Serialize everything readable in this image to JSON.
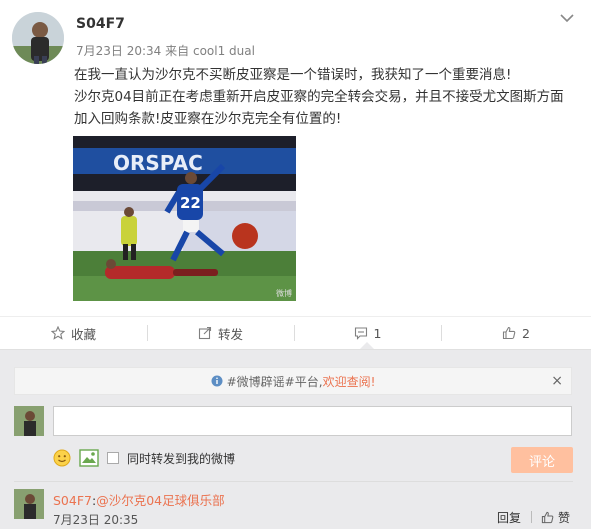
{
  "post": {
    "username": "S04F7",
    "date": "7月23日 20:34",
    "source_prefix": "来自",
    "source": "cool1 dual",
    "text_line1": "在我一直认为沙尔克不买断皮亚察是一个错误时，我获知了一个重要消息!",
    "text_line2": "沙尔克04目前正在考虑重新开启皮亚察的完全转会交易，并且不接受尤文图斯方面加入回购条款!皮亚察在沙尔克完全有位置的!",
    "image_watermark": "微博"
  },
  "actions": {
    "favorite": "收藏",
    "repost": "转发",
    "comment_count": "1",
    "like_count": "2"
  },
  "comments_section": {
    "notice_prefix": "#微博辟谣#平台,",
    "notice_link": "欢迎查阅!",
    "close_label": "×",
    "checkbox_label": "同时转发到我的微博",
    "submit_label": "评论",
    "comment": {
      "user": "S04F7",
      "colon": ":",
      "mention": "@沙尔克04足球俱乐部",
      "time": "7月23日 20:35",
      "reply": "回复",
      "like": "赞"
    }
  },
  "colors": {
    "accent": "#eb7350",
    "submit_bg": "#ffc09f",
    "comment_bg": "#eaeaec"
  },
  "icons": [
    "chevron-down-icon",
    "star-icon",
    "share-icon",
    "comment-icon",
    "thumbs-up-icon",
    "info-icon",
    "emoji-icon",
    "image-icon",
    "reply-icon"
  ]
}
